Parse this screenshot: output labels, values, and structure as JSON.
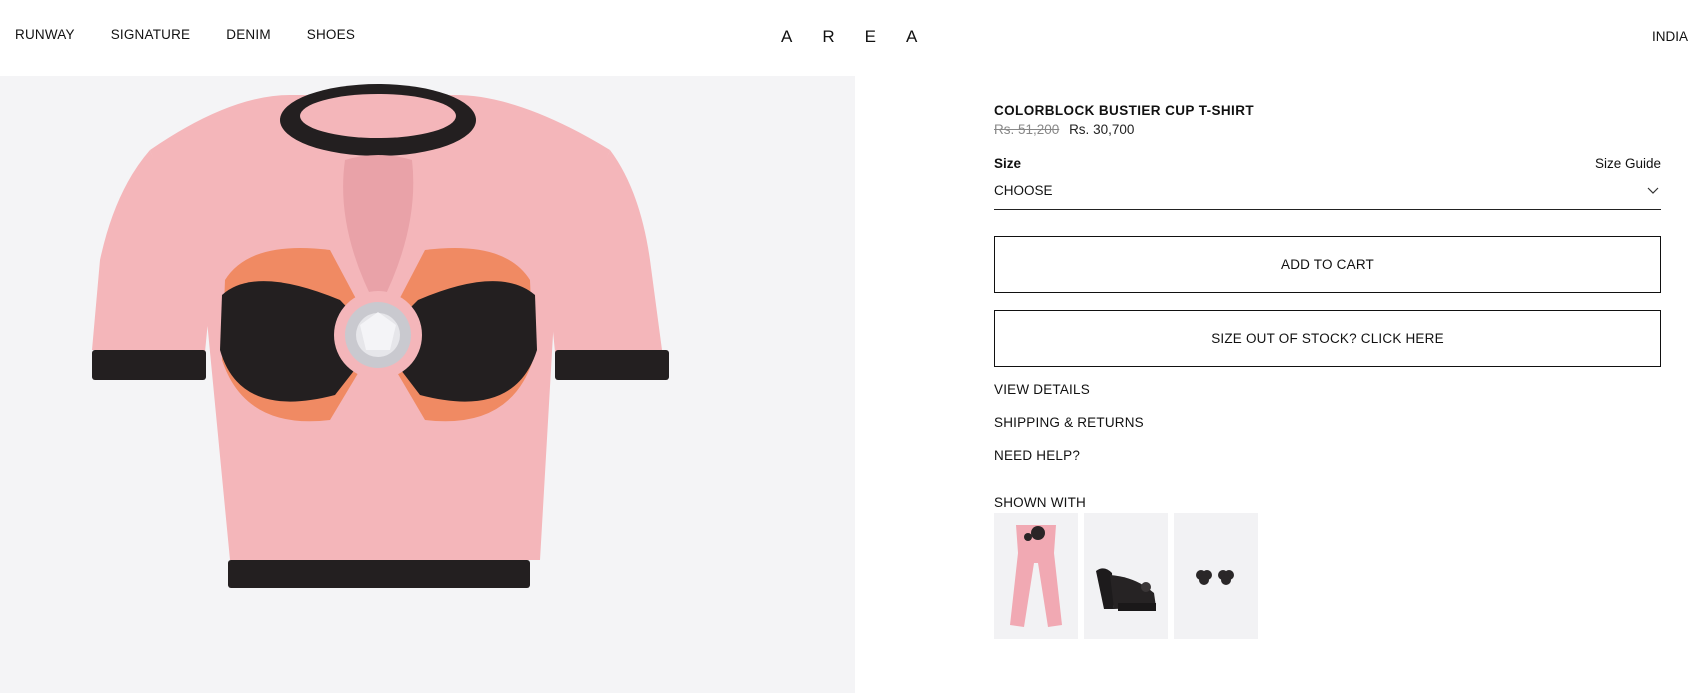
{
  "header": {
    "nav": [
      "RUNWAY",
      "SIGNATURE",
      "DENIM",
      "SHOES"
    ],
    "logo": "AREA",
    "region": "INDIA"
  },
  "product": {
    "title": "COLORBLOCK BUSTIER CUP T-SHIRT",
    "price_original": "Rs. 51,200",
    "price_sale": "Rs. 30,700",
    "size_label": "Size",
    "size_guide": "Size Guide",
    "size_selected": "CHOOSE",
    "add_to_cart": "ADD TO CART",
    "out_of_stock": "SIZE OUT OF STOCK? CLICK HERE",
    "links": [
      "VIEW DETAILS",
      "SHIPPING & RETURNS",
      "NEED HELP?"
    ],
    "shown_with_label": "SHOWN WITH"
  },
  "colors": {
    "gallery_bg": "#f4f4f6",
    "shirt_pink": "#f4b6ba",
    "trim_black": "#231f20",
    "cup_orange": "#f08a63"
  },
  "icons": [
    "chevron-down-icon"
  ]
}
